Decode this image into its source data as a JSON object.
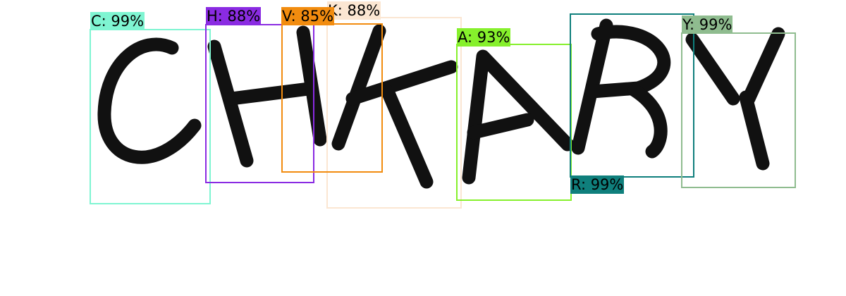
{
  "image": {
    "glyphs": "CHKARY",
    "ink_color": "#111111"
  },
  "detections": [
    {
      "char": "C",
      "label": "C: 99%",
      "confidence": 0.99,
      "color": "#7ff5d2"
    },
    {
      "char": "H",
      "label": "H: 88%",
      "confidence": 0.88,
      "color": "#8a2be2"
    },
    {
      "char": "V",
      "label": "V: 85%",
      "confidence": 0.85,
      "color": "#f28c0f"
    },
    {
      "char": "K",
      "label": "K: 88%",
      "confidence": 0.88,
      "color": "#fbe6d2"
    },
    {
      "char": "A",
      "label": "A: 93%",
      "confidence": 0.93,
      "color": "#86f02c"
    },
    {
      "char": "R",
      "label": "R: 99%",
      "confidence": 0.99,
      "color": "#0f7f7c"
    },
    {
      "char": "Y",
      "label": "Y: 99%",
      "confidence": 0.99,
      "color": "#8fbc8f"
    }
  ]
}
